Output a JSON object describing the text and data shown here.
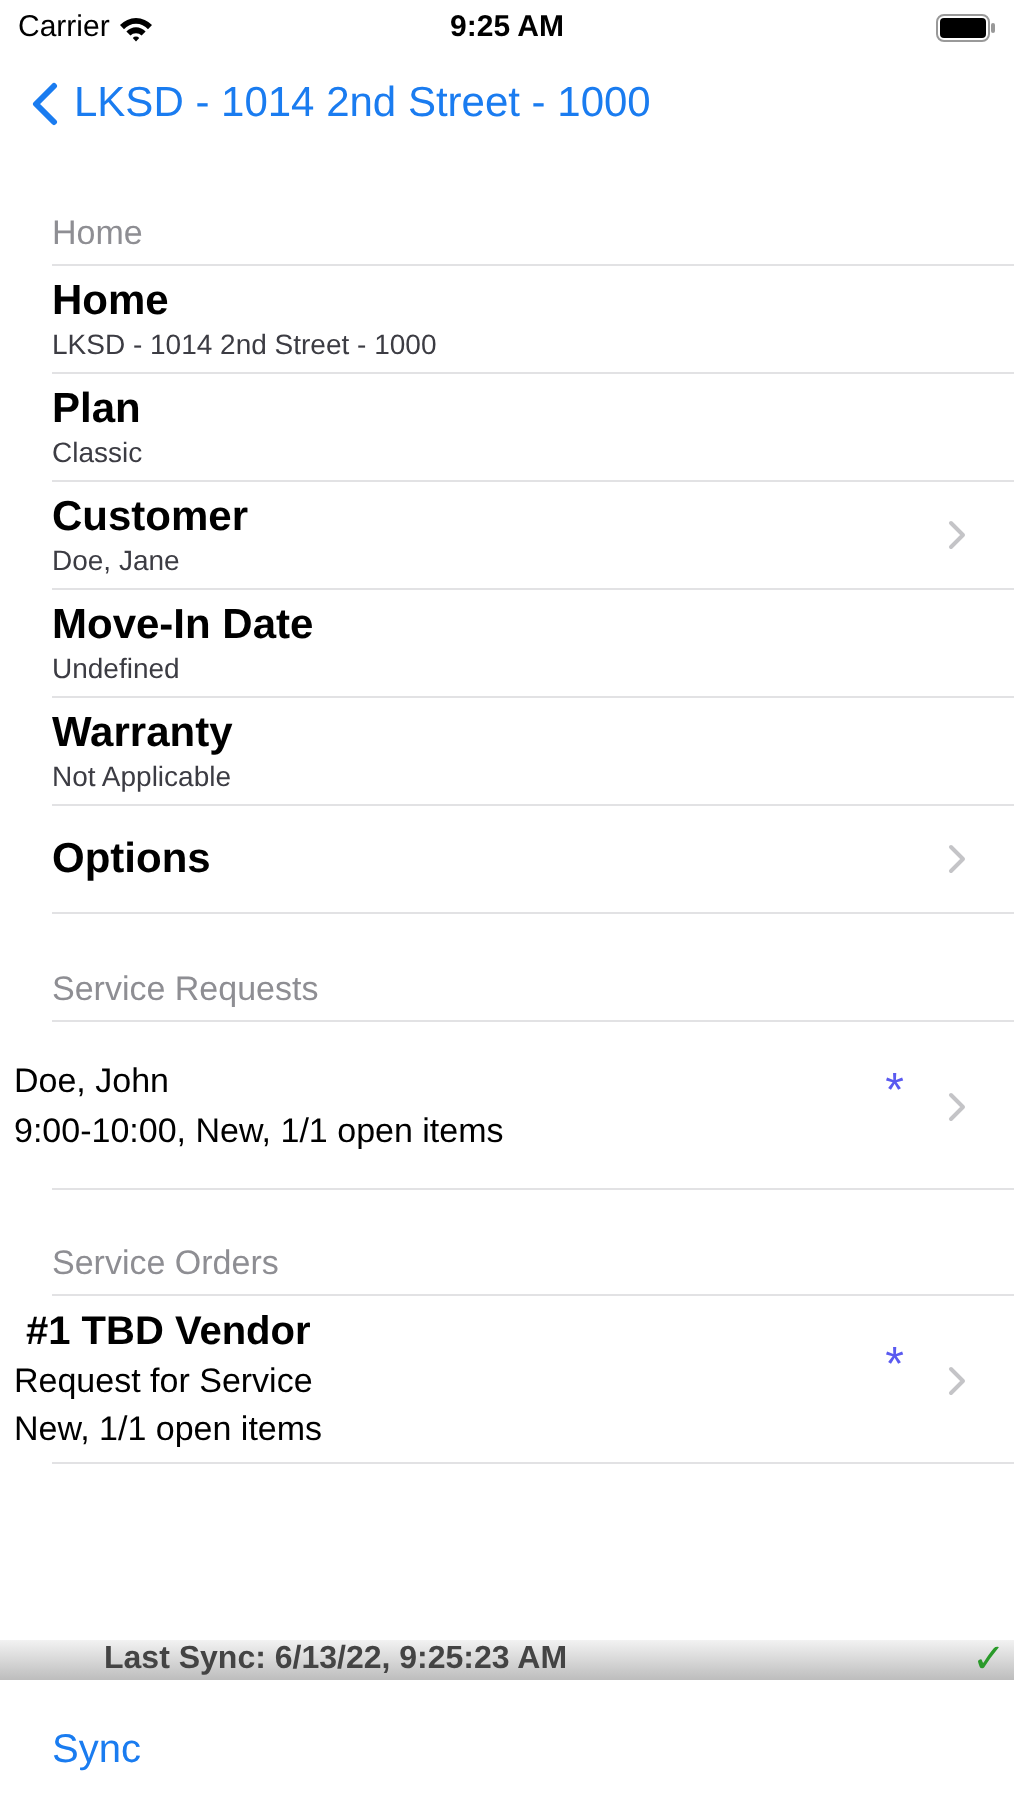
{
  "status_bar": {
    "carrier": "Carrier",
    "time": "9:25 AM"
  },
  "nav": {
    "back_title": "LKSD - 1014 2nd Street - 1000"
  },
  "home_section": {
    "header": "Home",
    "rows": [
      {
        "title": "Home",
        "subtitle": "LKSD - 1014 2nd Street - 1000",
        "chevron": false
      },
      {
        "title": "Plan",
        "subtitle": "Classic",
        "chevron": false
      },
      {
        "title": "Customer",
        "subtitle": "Doe, Jane",
        "chevron": true
      },
      {
        "title": "Move-In Date",
        "subtitle": "Undefined",
        "chevron": false
      },
      {
        "title": "Warranty",
        "subtitle": "Not Applicable",
        "chevron": false
      },
      {
        "title": "Options",
        "chevron": true
      }
    ]
  },
  "service_requests": {
    "header": "Service Requests",
    "rows": [
      {
        "lines": [
          "Doe, John",
          "9:00-10:00, New, 1/1 open items"
        ],
        "marker": "*",
        "chevron": true
      }
    ]
  },
  "service_orders": {
    "header": "Service Orders",
    "rows": [
      {
        "title": "#1 TBD Vendor",
        "lines": [
          "Request for Service",
          "New, 1/1 open items"
        ],
        "marker": "*",
        "chevron": true
      }
    ]
  },
  "sync_bar": {
    "text": "Last Sync: 6/13/22, 9:25:23 AM",
    "status_mark": "✓"
  },
  "toolbar": {
    "button": "Sync"
  }
}
